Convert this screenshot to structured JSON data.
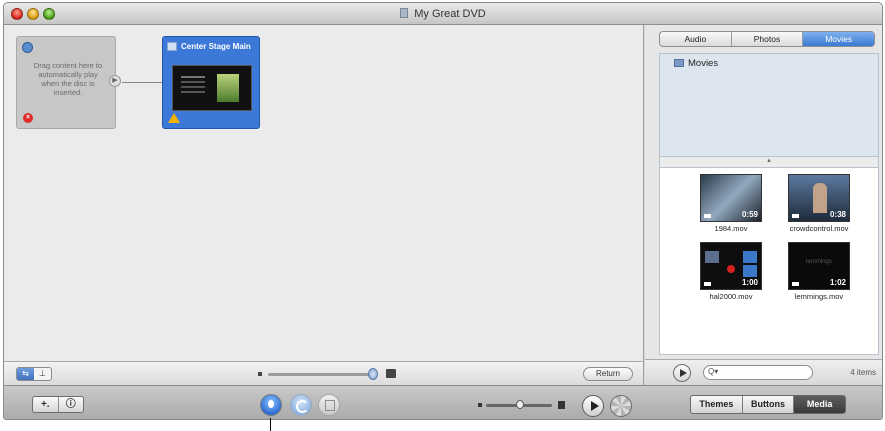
{
  "window": {
    "title": "My Great DVD"
  },
  "canvas": {
    "first_play": {
      "text": "Drag content here to automatically play when the disc is inserted."
    },
    "main_menu": {
      "label": "Center Stage Main"
    },
    "return_label": "Return"
  },
  "panel": {
    "tabs": [
      {
        "label": "Audio",
        "active": false
      },
      {
        "label": "Photos",
        "active": false
      },
      {
        "label": "Movies",
        "active": true
      }
    ],
    "source": {
      "label": "Movies"
    },
    "media": [
      {
        "file": "1984.mov",
        "duration": "0:59",
        "thumb": "th1"
      },
      {
        "file": "crowdcontrol.mov",
        "duration": "0:38",
        "thumb": "th2"
      },
      {
        "file": "hal2000.mov",
        "duration": "1:00",
        "thumb": "th3"
      },
      {
        "file": "lemmings.mov",
        "duration": "1:02",
        "thumb": "th4",
        "overlay": "lemmings"
      }
    ],
    "search": {
      "placeholder": "",
      "value": ""
    },
    "item_count": "4 items"
  },
  "toolbar": {
    "view_tabs": [
      {
        "label": "Themes",
        "active": false
      },
      {
        "label": "Buttons",
        "active": false
      },
      {
        "label": "Media",
        "active": true
      }
    ]
  },
  "colors": {
    "accent": "#3c78d8",
    "warning": "#f0b400",
    "error": "#e02a2a"
  },
  "icons": {
    "close": "close-window-icon",
    "minimize": "minimize-window-icon",
    "zoom": "zoom-window-icon",
    "map_view": "map-view-icon",
    "motion": "motion-icon",
    "burn": "burn-icon",
    "play": "play-icon",
    "search": "search-icon"
  }
}
